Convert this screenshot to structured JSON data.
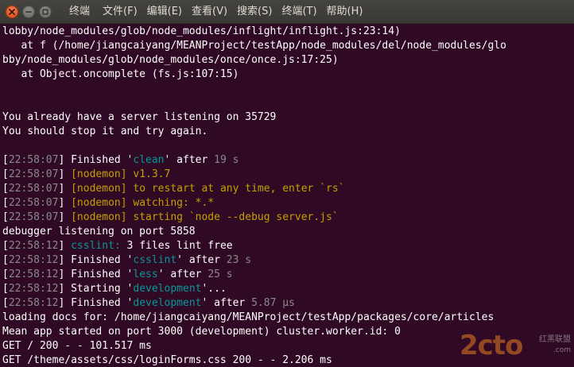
{
  "window": {
    "title": "终端",
    "buttons": {
      "close_icon": "close-icon",
      "minimize_icon": "minimize-icon",
      "maximize_icon": "maximize-icon"
    }
  },
  "menu": {
    "items": [
      "文件(F)",
      "编辑(E)",
      "查看(V)",
      "搜索(S)",
      "终端(T)",
      "帮助(H)"
    ]
  },
  "colors": {
    "background": "#300a24",
    "text": "#ffffff",
    "timestamp_bracket": "#8a8a8a",
    "cyan": "#06989a",
    "yellow": "#c4a000",
    "gray": "#8a8a8a"
  },
  "terminal": {
    "lines": [
      [
        {
          "t": "lobby/node_modules/glob/node_modules/inflight/inflight.js:23:14)",
          "c": "white"
        }
      ],
      [
        {
          "t": "   at f (/home/jiangcaiyang/MEANProject/testApp/node_modules/del/node_modules/glo",
          "c": "white"
        }
      ],
      [
        {
          "t": "bby/node_modules/glob/node_modules/once/once.js:17:25)",
          "c": "white"
        }
      ],
      [
        {
          "t": "   at Object.oncomplete (fs.js:107:15)",
          "c": "white"
        }
      ],
      [
        {
          "t": "",
          "c": "white"
        }
      ],
      [
        {
          "t": "",
          "c": "white"
        }
      ],
      [
        {
          "t": "You already have a server listening on 35729",
          "c": "white"
        }
      ],
      [
        {
          "t": "You should stop it and try again.",
          "c": "white"
        }
      ],
      [
        {
          "t": "",
          "c": "white"
        }
      ],
      [
        {
          "t": "[",
          "c": "white"
        },
        {
          "t": "22:58:07",
          "c": "gray"
        },
        {
          "t": "] Finished '",
          "c": "white"
        },
        {
          "t": "clean",
          "c": "cyan"
        },
        {
          "t": "' after ",
          "c": "white"
        },
        {
          "t": "19 s",
          "c": "gray"
        }
      ],
      [
        {
          "t": "[",
          "c": "white"
        },
        {
          "t": "22:58:07",
          "c": "gray"
        },
        {
          "t": "] ",
          "c": "white"
        },
        {
          "t": "[nodemon] v1.3.7",
          "c": "yellow"
        }
      ],
      [
        {
          "t": "[",
          "c": "white"
        },
        {
          "t": "22:58:07",
          "c": "gray"
        },
        {
          "t": "] ",
          "c": "white"
        },
        {
          "t": "[nodemon] to restart at any time, enter `rs`",
          "c": "yellow"
        }
      ],
      [
        {
          "t": "[",
          "c": "white"
        },
        {
          "t": "22:58:07",
          "c": "gray"
        },
        {
          "t": "] ",
          "c": "white"
        },
        {
          "t": "[nodemon] watching: *.*",
          "c": "yellow"
        }
      ],
      [
        {
          "t": "[",
          "c": "white"
        },
        {
          "t": "22:58:07",
          "c": "gray"
        },
        {
          "t": "] ",
          "c": "white"
        },
        {
          "t": "[nodemon] starting `node --debug server.js`",
          "c": "yellow"
        }
      ],
      [
        {
          "t": "debugger listening on port 5858",
          "c": "white"
        }
      ],
      [
        {
          "t": "[",
          "c": "white"
        },
        {
          "t": "22:58:12",
          "c": "gray"
        },
        {
          "t": "] ",
          "c": "white"
        },
        {
          "t": "csslint:",
          "c": "cyan"
        },
        {
          "t": " 3 files lint free",
          "c": "white"
        }
      ],
      [
        {
          "t": "[",
          "c": "white"
        },
        {
          "t": "22:58:12",
          "c": "gray"
        },
        {
          "t": "] Finished '",
          "c": "white"
        },
        {
          "t": "csslint",
          "c": "cyan"
        },
        {
          "t": "' after ",
          "c": "white"
        },
        {
          "t": "23 s",
          "c": "gray"
        }
      ],
      [
        {
          "t": "[",
          "c": "white"
        },
        {
          "t": "22:58:12",
          "c": "gray"
        },
        {
          "t": "] Finished '",
          "c": "white"
        },
        {
          "t": "less",
          "c": "cyan"
        },
        {
          "t": "' after ",
          "c": "white"
        },
        {
          "t": "25 s",
          "c": "gray"
        }
      ],
      [
        {
          "t": "[",
          "c": "white"
        },
        {
          "t": "22:58:12",
          "c": "gray"
        },
        {
          "t": "] Starting '",
          "c": "white"
        },
        {
          "t": "development",
          "c": "cyan"
        },
        {
          "t": "'...",
          "c": "white"
        }
      ],
      [
        {
          "t": "[",
          "c": "white"
        },
        {
          "t": "22:58:12",
          "c": "gray"
        },
        {
          "t": "] Finished '",
          "c": "white"
        },
        {
          "t": "development",
          "c": "cyan"
        },
        {
          "t": "' after ",
          "c": "white"
        },
        {
          "t": "5.87 μs",
          "c": "gray"
        }
      ],
      [
        {
          "t": "loading docs for: /home/jiangcaiyang/MEANProject/testApp/packages/core/articles",
          "c": "white"
        }
      ],
      [
        {
          "t": "Mean app started on port 3000 (development) cluster.worker.id: 0",
          "c": "white"
        }
      ],
      [
        {
          "t": "GET / 200 - - 101.517 ms",
          "c": "white"
        }
      ],
      [
        {
          "t": "GET /theme/assets/css/loginForms.css 200 - - 2.206 ms",
          "c": "white"
        }
      ]
    ]
  },
  "watermark": {
    "main": "2cto",
    "sub": "红黑联盟",
    "sub2": ".com"
  }
}
